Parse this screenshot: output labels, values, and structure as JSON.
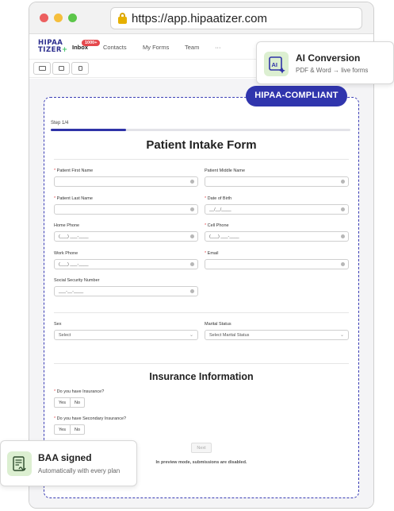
{
  "browser": {
    "url": "https://app.hipaatizer.com"
  },
  "app": {
    "logo_line1": "HIPAA",
    "logo_line2": "TIZER",
    "logo_plus": "+",
    "nav": {
      "inbox": "Inbox",
      "inbox_badge": "1000+",
      "contacts": "Contacts",
      "my_forms": "My Forms",
      "team": "Team",
      "more": "···"
    },
    "device_views": [
      "desktop-view",
      "tablet-view",
      "mobile-view"
    ]
  },
  "badge_hipaa": "HIPAA-COMPLIANT",
  "ai_card": {
    "title": "AI Conversion",
    "subtitle": "PDF & Word → live forms",
    "icon": "ai-sparkle-icon"
  },
  "baa_card": {
    "title": "BAA signed",
    "subtitle": "Automatically with every plan",
    "icon": "signed-document-icon"
  },
  "form": {
    "step": "Step 1/4",
    "progress": 0.25,
    "title": "Patient Intake Form",
    "required_mark": "*",
    "fields": {
      "first_name": "Patient First Name",
      "middle_name": "Patient Middle Name",
      "last_name": "Patient Last Name",
      "dob": "Date of Birth",
      "dob_placeholder": "__/__/____",
      "home_phone": "Home Phone",
      "cell_phone": "Cell Phone",
      "work_phone": "Work Phone",
      "email": "Email",
      "phone_placeholder": "(___) ___-____",
      "ssn": "Social Security Number",
      "ssn_placeholder": "___-__-____",
      "sex": "Sex",
      "sex_placeholder": "Select",
      "marital": "Marital Status",
      "marital_placeholder": "Select Marital Status"
    },
    "insurance": {
      "title": "Insurance Information",
      "q1": "Do you have Insurance?",
      "q2": "Do you have Secondary Insurance?",
      "yes": "Yes",
      "no": "No"
    },
    "next": "Next",
    "preview_note": "In preview mode, submissions are disabled."
  },
  "colors": {
    "brand": "#2f33a8",
    "required": "#e5484d",
    "card_icon_bg": "#dcefd1"
  }
}
